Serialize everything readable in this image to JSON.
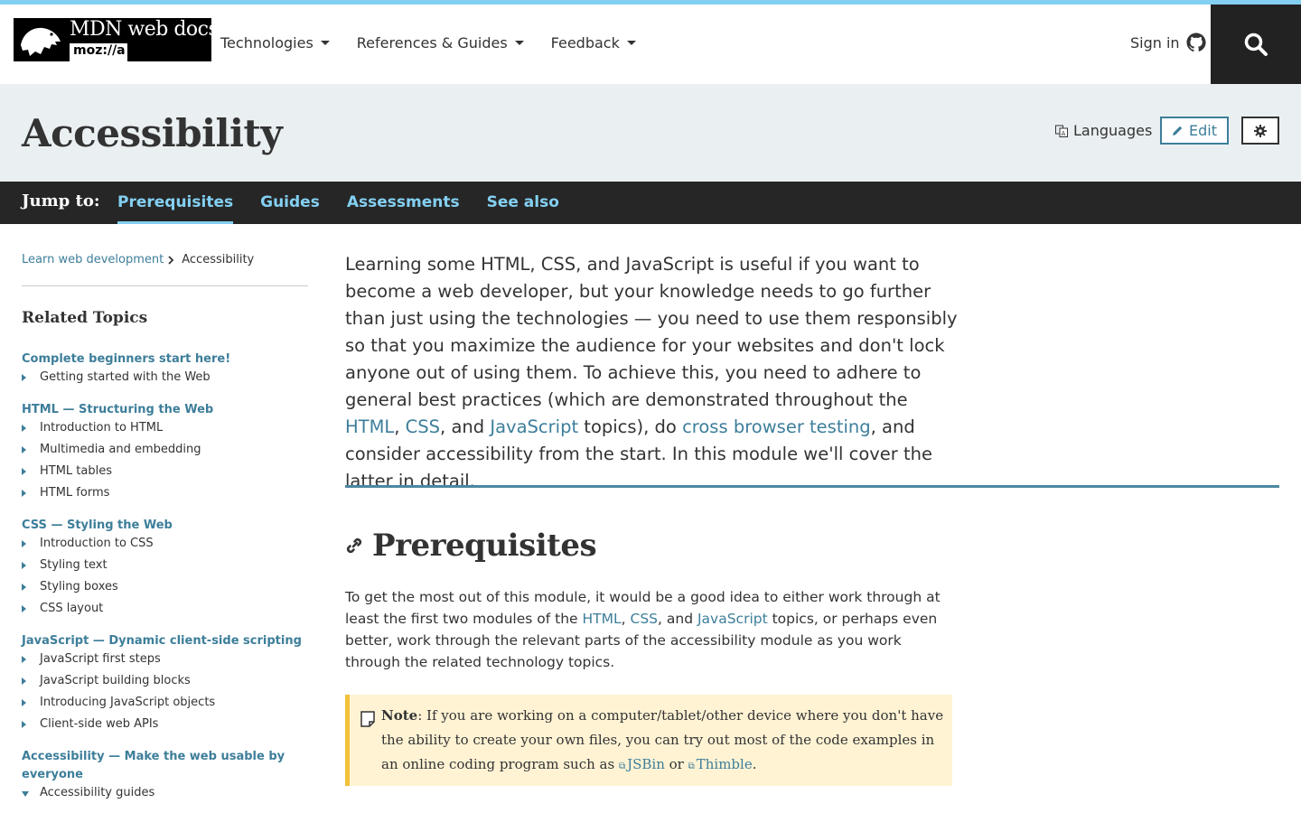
{
  "header": {
    "logo_text": "MDN web docs",
    "logo_sub": "moz://a",
    "nav": [
      {
        "label": "Technologies"
      },
      {
        "label": "References & Guides"
      },
      {
        "label": "Feedback"
      }
    ],
    "signin_label": "Sign in"
  },
  "titlebar": {
    "title": "Accessibility",
    "languages_label": "Languages",
    "edit_label": "Edit"
  },
  "jumpbar": {
    "label": "Jump to:",
    "links": [
      "Prerequisites",
      "Guides",
      "Assessments",
      "See also"
    ]
  },
  "sidebar": {
    "breadcrumb": {
      "parent": "Learn web development",
      "current": "Accessibility"
    },
    "related_title": "Related Topics",
    "groups": [
      {
        "title": "Complete beginners start here!",
        "items": [
          "Getting started with the Web"
        ]
      },
      {
        "title": "HTML — Structuring the Web",
        "items": [
          "Introduction to HTML",
          "Multimedia and embedding",
          "HTML tables",
          "HTML forms"
        ]
      },
      {
        "title": "CSS — Styling the Web",
        "items": [
          "Introduction to CSS",
          "Styling text",
          "Styling boxes",
          "CSS layout"
        ]
      },
      {
        "title": "JavaScript — Dynamic client-side scripting",
        "items": [
          "JavaScript first steps",
          "JavaScript building blocks",
          "Introducing JavaScript objects",
          "Client-side web APIs"
        ]
      },
      {
        "title": "Accessibility — Make the web usable by everyone",
        "items": [
          "Accessibility guides"
        ]
      }
    ]
  },
  "main": {
    "intro": {
      "t1": "Learning some HTML, CSS, and JavaScript is useful if you want to become a web developer, but your knowledge needs to go further than just using the technologies — you need to use them responsibly so that you maximize the audience for your websites and don't lock anyone out of using them. To achieve this, you need to adhere to general best practices (which are demonstrated throughout the ",
      "l_html": "HTML",
      "t2": ", ",
      "l_css": "CSS",
      "t3": ", and ",
      "l_js": "JavaScript",
      "t4": " topics), do ",
      "l_cbt": "cross browser testing",
      "t5": ", and consider accessibility from the start. In this module we'll cover the latter in detail."
    },
    "prereq": {
      "heading": "Prerequisites",
      "p1": "To get the most out of this module, it would be a good idea to either work through at least the first two modules of the ",
      "l_html": "HTML",
      "p2": ", ",
      "l_css": "CSS",
      "p3": ", and ",
      "l_js": "JavaScript",
      "p4": " topics, or perhaps even better, work through the relevant parts of the accessibility module as you work through the related technology topics."
    },
    "note": {
      "label": "Note",
      "t1": ": If you are working on a computer/tablet/other device where you don't have the ability to create your own files, you can try out most of the code examples in an online coding program such as ",
      "l_jsbin": "JSBin",
      "t2": " or ",
      "l_thimble": "Thimble",
      "t3": "."
    }
  }
}
